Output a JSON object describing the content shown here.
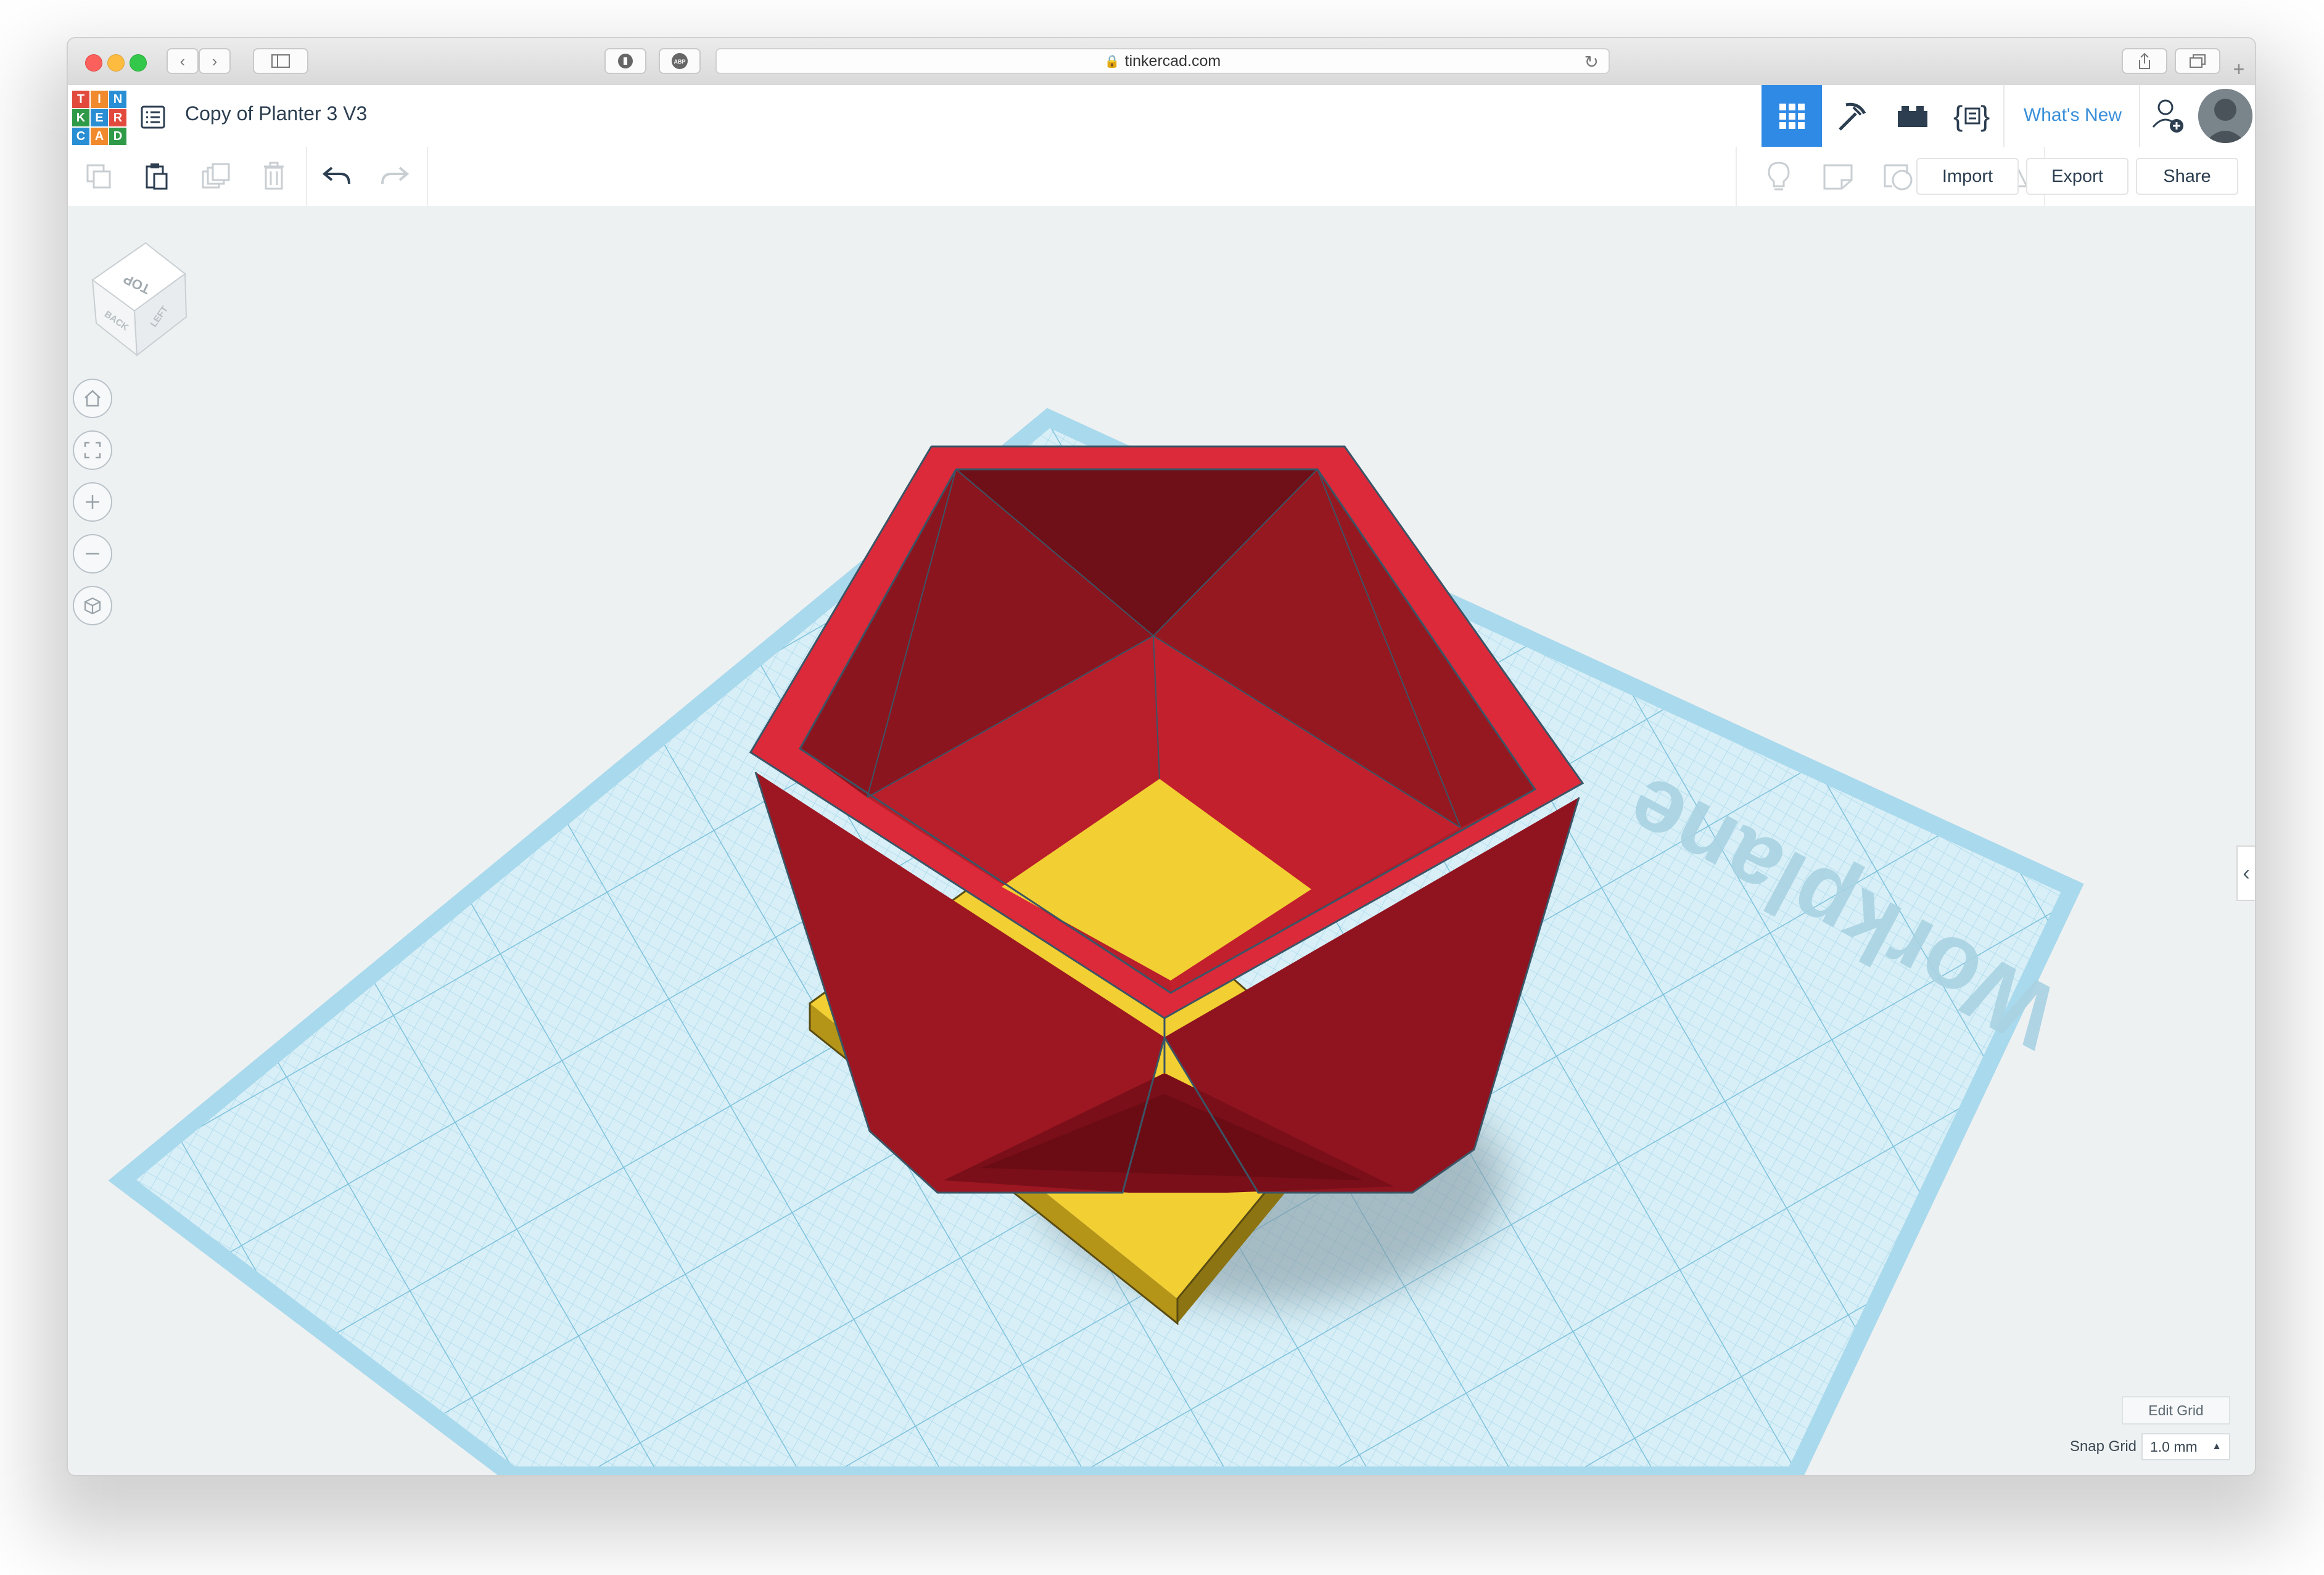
{
  "browser": {
    "url": "tinkercad.com"
  },
  "app": {
    "logo_letters": [
      "T",
      "I",
      "N",
      "K",
      "E",
      "R",
      "C",
      "A",
      "D"
    ],
    "document_title": "Copy of Planter 3 V3",
    "whats_new": "What's New"
  },
  "toolbar": {
    "import_label": "Import",
    "export_label": "Export",
    "share_label": "Share"
  },
  "viewcube": {
    "top": "TOP",
    "back": "BACK",
    "left": "LEFT"
  },
  "workplane": {
    "label": "Workplane"
  },
  "grid": {
    "edit_label": "Edit Grid",
    "snap_label": "Snap Grid",
    "snap_value": "1.0 mm"
  },
  "colors": {
    "accent": "#2f8ae6",
    "planter_red": "#c8202f",
    "base_yellow": "#f2cf33",
    "workplane_blue": "#bfe3f2"
  }
}
